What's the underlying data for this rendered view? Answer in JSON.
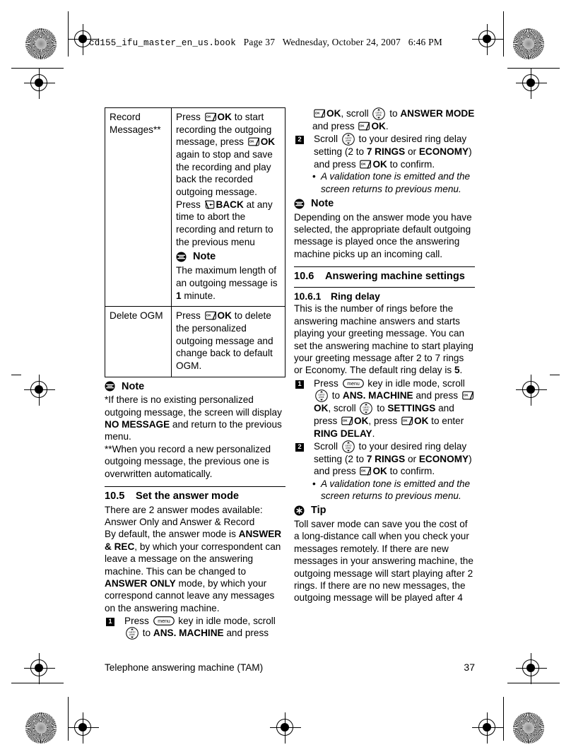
{
  "slug": {
    "filename": "cd155_ifu_master_en_us.book",
    "page_label": "Page 37",
    "date": "Wednesday, October 24, 2007",
    "time": "6:46 PM"
  },
  "left_column": {
    "table": {
      "rows": [
        {
          "key": "Record Messages**",
          "desc_1": "Press ",
          "desc_2": "OK",
          "desc_3": " to start recording the outgoing message, press ",
          "desc_4": "OK",
          "desc_5": " again to stop and save the recording and play back the recorded outgoing message. Press ",
          "desc_6": "BACK",
          "desc_7": " at any time to abort the recording and return to the previous menu",
          "note_label": "Note",
          "note_text_1": "The maximum length of an outgoing message is ",
          "note_bold": "1",
          "note_text_2": " minute."
        },
        {
          "key": "Delete OGM",
          "desc_1": "Press ",
          "desc_2": "OK",
          "desc_3": " to delete the personalized outgoing message and change back to default OGM."
        }
      ]
    },
    "note_label": "Note",
    "footnote_1a": "*If there is no existing personalized outgoing message, the screen will display ",
    "footnote_1b": "NO MESSAGE",
    "footnote_1c": " and return to the previous menu.",
    "footnote_2": "**When you record a new personalized outgoing message, the previous one is overwritten automatically.",
    "section": {
      "number": "10.5",
      "title": "Set the answer mode"
    },
    "body_1": "There are 2 answer modes available:",
    "body_2": "Answer Only and Answer & Record",
    "body_3a": "By default, the answer mode is ",
    "body_3b": "ANSWER & REC",
    "body_3c": ", by which your correspondent can leave a message on the answering machine. This can be changed to ",
    "body_3d": "ANSWER ONLY",
    "body_3e": " mode, by which your correspond cannot leave any messages on the answering machine.",
    "step_1": {
      "num": "1",
      "t1": "Press ",
      "t2": " key in idle mode, scroll ",
      "t3": " to ",
      "t4": "ANS. MACHINE",
      "t5": " and press"
    }
  },
  "right_column": {
    "cont": {
      "t1": "OK",
      "t2": ", scroll ",
      "t3": " to ",
      "t4": "ANSWER MODE",
      "t5": " and press ",
      "t6": "OK",
      "t7": "."
    },
    "step_2": {
      "num": "2",
      "t1": "Scroll ",
      "t2": " to your desired ring delay setting (2 to ",
      "t3": "7 RINGS",
      "t4": " or ",
      "t5": "ECONOMY",
      "t6": ") and press ",
      "t7": "OK",
      "t8": " to confirm.",
      "bullet": "A validation tone is emitted and the screen returns to previous menu."
    },
    "note_label": "Note",
    "note_body": "Depending on the answer mode you have selected, the appropriate default outgoing message is played once the answering machine picks up an incoming call.",
    "section": {
      "number": "10.6",
      "title": "Answering machine settings"
    },
    "subsection": {
      "number": "10.6.1",
      "title": "Ring delay"
    },
    "ring_body_a": "This is the number of rings before the answering machine answers and starts playing your greeting message. You can set the answering machine to start playing your greeting message after 2 to 7 rings or Economy. The default ring delay is ",
    "ring_body_b": "5",
    "ring_body_c": ".",
    "step_1": {
      "num": "1",
      "t1": "Press ",
      "t2": " key in idle mode, scroll ",
      "t3": " to ",
      "t4": "ANS. MACHINE",
      "t5": " and press ",
      "t6": "OK",
      "t7": ", scroll ",
      "t8": " to ",
      "t9": "SETTINGS",
      "t10": " and press ",
      "t11": "OK",
      "t12": ", press ",
      "t13": "OK",
      "t14": " to enter ",
      "t15": "RING DELAY",
      "t16": "."
    },
    "tip_label": "Tip",
    "tip_body": "Toll saver mode can save you the cost of a long-distance call when you check your messages remotely. If there are new messages in your answering machine, the outgoing message will start playing after 2 rings. If there are no new messages, the outgoing message will be played after 4"
  },
  "footer": {
    "chapter": "Telephone answering machine (TAM)",
    "page_number": "37"
  },
  "icons": {
    "ok_key": "ok-soft-key-icon",
    "back_key": "back-soft-key-icon",
    "menu_key": "menu-key-icon",
    "scroll_key": "scroll-navigation-key-icon",
    "note": "note-icon",
    "tip": "tip-icon",
    "registration": "registration-mark-icon",
    "density": "density-star-target-icon"
  },
  "colors": {
    "ink": "#000000",
    "paper": "#ffffff"
  }
}
